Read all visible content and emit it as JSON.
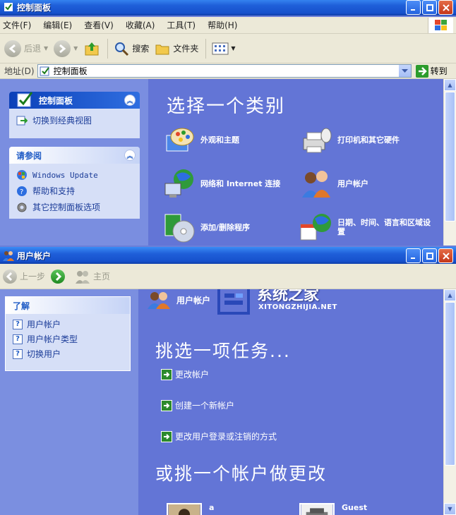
{
  "window1": {
    "title": "控制面板",
    "menu": [
      "文件(F)",
      "编辑(E)",
      "查看(V)",
      "收藏(A)",
      "工具(T)",
      "帮助(H)"
    ],
    "toolbar": {
      "back": "后退",
      "search": "搜索",
      "folders": "文件夹"
    },
    "address": {
      "label": "地址(D)",
      "value": "控制面板",
      "go": "转到"
    },
    "panel_control": {
      "title": "控制面板",
      "items": [
        "切换到经典视图"
      ]
    },
    "panel_see_also": {
      "title": "请参阅",
      "items": [
        "Windows Update",
        "帮助和支持",
        "其它控制面板选项"
      ]
    },
    "heading": "选择一个类别",
    "categories": [
      "外观和主题",
      "打印机和其它硬件",
      "网络和 Internet 连接",
      "用户帐户",
      "添加/删除程序",
      "日期、时间、语言和区域设置"
    ]
  },
  "window2": {
    "title": "用户帐户",
    "toolbar": {
      "back": "上一步",
      "home": "主页"
    },
    "learn": {
      "title": "了解",
      "items": [
        "用户帐户",
        "用户帐户类型",
        "切换用户"
      ]
    },
    "section_title": "用户帐户",
    "watermark": {
      "name": "系统之家",
      "url": "XITONGZHIJIA.NET"
    },
    "heading_task": "挑选一项任务...",
    "tasks": [
      "更改帐户",
      "创建一个新帐户",
      "更改用户登录或注销的方式"
    ],
    "heading_account": "或挑一个帐户做更改",
    "accounts": [
      "a",
      "Guest"
    ]
  },
  "colors": {
    "title_blue": "#1651cc",
    "task_bg": "#6375d6",
    "panel_bg": "#d6dff7",
    "link": "#1c3d99"
  }
}
